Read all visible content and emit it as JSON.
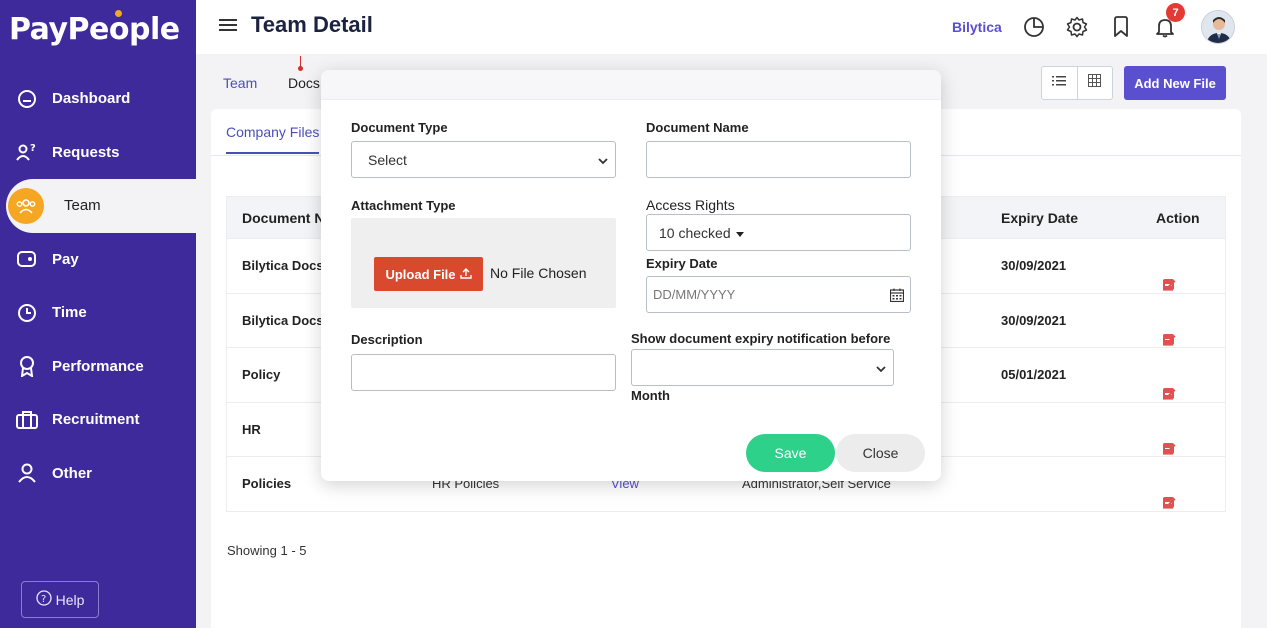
{
  "app": {
    "logo_text_a": "PayPe",
    "logo_text_b": "ple"
  },
  "sidebar": {
    "items": [
      {
        "label": "Dashboard",
        "icon": "dashboard-icon"
      },
      {
        "label": "Requests",
        "icon": "requests-icon"
      },
      {
        "label": "Team",
        "icon": "team-icon"
      },
      {
        "label": "Pay",
        "icon": "wallet-icon"
      },
      {
        "label": "Time",
        "icon": "clock-icon"
      },
      {
        "label": "Performance",
        "icon": "award-icon"
      },
      {
        "label": "Recruitment",
        "icon": "briefcase-icon"
      },
      {
        "label": "Other",
        "icon": "user-icon"
      }
    ],
    "active": "Team",
    "help_label": "Help"
  },
  "header": {
    "title": "Team Detail",
    "company": "Bilytica",
    "notification_count": "7"
  },
  "breadcrumb": {
    "team": "Team",
    "docs": "Docs"
  },
  "toolbar": {
    "add_file_label": "Add New File"
  },
  "tabs": {
    "company_files": "Company Files"
  },
  "table": {
    "headers": {
      "document_name": "Document N",
      "expiry_date": "Expiry Date",
      "action": "Action"
    },
    "rows": [
      {
        "name": "Bilytica Docs",
        "expiry": "30/09/2021"
      },
      {
        "name": "Bilytica Docs",
        "expiry": "30/09/2021"
      },
      {
        "name": "Policy",
        "expiry": "05/01/2021"
      },
      {
        "name": "HR",
        "expiry": ""
      },
      {
        "name": "Policies",
        "expiry": "",
        "partial_type": "HR Policies",
        "partial_view": "View",
        "partial_access": "Administrator,Self Service"
      }
    ],
    "showing": "Showing 1 - 5"
  },
  "modal": {
    "document_type_label": "Document Type",
    "document_type_value": "Select",
    "document_name_label": "Document Name",
    "document_name_value": "",
    "attachment_type_label": "Attachment Type",
    "upload_label": "Upload File",
    "no_file_label": "No File Chosen",
    "access_rights_label": "Access Rights",
    "access_rights_value": "10 checked",
    "expiry_date_label": "Expiry Date",
    "expiry_date_placeholder": "DD/MM/YYYY",
    "description_label": "Description",
    "description_value": "",
    "notify_label": "Show document expiry notification before",
    "notify_value": "",
    "notify_unit": "Month",
    "save_label": "Save",
    "close_label": "Close"
  },
  "colors": {
    "sidebar": "#3e2a9a",
    "accent": "#5a4fcf",
    "team_icon_bg": "#f5a623",
    "upload": "#d9492e",
    "save": "#2ed18a",
    "badge": "#e53935"
  }
}
